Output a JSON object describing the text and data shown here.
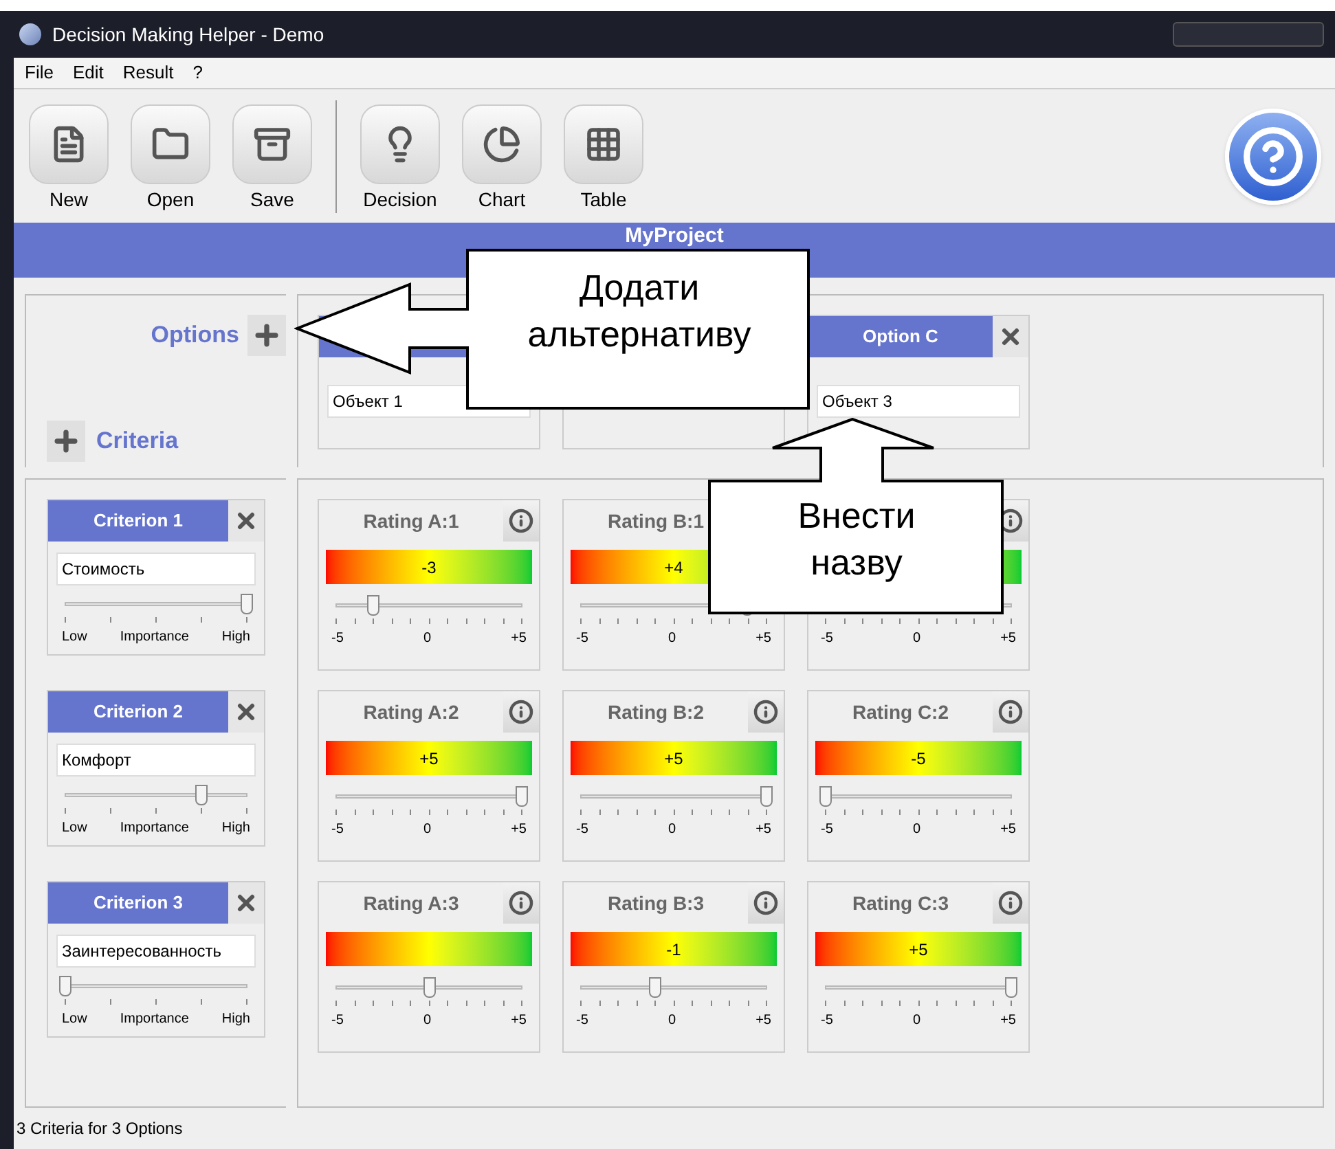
{
  "window": {
    "title": "Decision Making Helper - Demo"
  },
  "menu": [
    "File",
    "Edit",
    "Result",
    "?"
  ],
  "toolbar": [
    {
      "label": "New",
      "kind": "new"
    },
    {
      "label": "Open",
      "kind": "open"
    },
    {
      "label": "Save",
      "kind": "save"
    },
    {
      "label": "Decision",
      "kind": "decision"
    },
    {
      "label": "Chart",
      "kind": "chart"
    },
    {
      "label": "Table",
      "kind": "table"
    }
  ],
  "project_title": "MyProject",
  "options_label": "Options",
  "criteria_label": "Criteria",
  "options": [
    {
      "kind": "named",
      "value": "Объект 1"
    },
    {
      "kind": "covered"
    },
    {
      "kind": "named",
      "title": "Option C",
      "value": "Объект 3"
    }
  ],
  "criteria": [
    {
      "title": "Criterion 1",
      "value": "Стоимость",
      "level": 1,
      "low": "Low",
      "mid": "Importance",
      "high": "High"
    },
    {
      "title": "Criterion 2",
      "value": "Комфорт",
      "level": 0.75,
      "low": "Low",
      "mid": "Importance",
      "high": "High"
    },
    {
      "title": "Criterion 3",
      "value": "Заинтересованность",
      "level": 0,
      "low": "Low",
      "mid": "Importance",
      "high": "High"
    }
  ],
  "ratings": [
    [
      {
        "title": "Rating A:1",
        "reading": "-3",
        "level": 0.2,
        "min": "-5",
        "zero": "0",
        "max": "+5"
      },
      {
        "title": "Rating B:1",
        "reading": "+4",
        "level": 0.9,
        "min": "-5",
        "zero": "0",
        "max": "+5"
      },
      {
        "min": "-5",
        "zero": "0",
        "max": "+5"
      }
    ],
    [
      {
        "title": "Rating A:2",
        "reading": "+5",
        "level": 1,
        "min": "-5",
        "zero": "0",
        "max": "+5"
      },
      {
        "title": "Rating B:2",
        "reading": "+5",
        "level": 1,
        "min": "-5",
        "zero": "0",
        "max": "+5"
      },
      {
        "title": "Rating C:2",
        "reading": "-5",
        "level": 0,
        "min": "-5",
        "zero": "0",
        "max": "+5"
      }
    ],
    [
      {
        "title": "Rating A:3",
        "level": 0.5,
        "min": "-5",
        "zero": "0",
        "max": "+5"
      },
      {
        "title": "Rating B:3",
        "reading": "-1",
        "level": 0.4,
        "min": "-5",
        "zero": "0",
        "max": "+5"
      },
      {
        "title": "Rating C:3",
        "reading": "+5",
        "level": 1,
        "min": "-5",
        "zero": "0",
        "max": "+5"
      }
    ]
  ],
  "status_bar": "3 Criteria for 3 Options",
  "callouts": [
    {
      "kind": "left",
      "text": "Додати альтернативу"
    },
    {
      "kind": "up",
      "text": "Внести назву"
    }
  ]
}
